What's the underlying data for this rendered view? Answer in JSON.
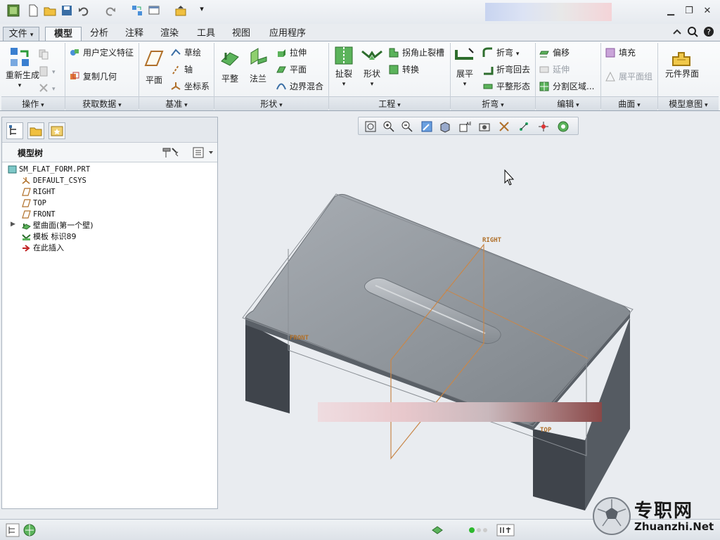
{
  "tabs": [
    "文件",
    "模型",
    "分析",
    "注释",
    "渲染",
    "工具",
    "视图",
    "应用程序"
  ],
  "ribbon": {
    "operations": {
      "regenerate": "重新生成",
      "label": "操作"
    },
    "get_data": {
      "udf": "用户定义特征",
      "copy_geometry": "复制几何",
      "label": "获取数据"
    },
    "datum": {
      "plane": "平面",
      "sketch": "草绘",
      "axis": "轴",
      "csys": "坐标系",
      "label": "基准"
    },
    "shapes": {
      "flat": "平整",
      "flange": "法兰",
      "extrude": "拉伸",
      "planar": "平面",
      "blend": "边界混合",
      "label": "形状"
    },
    "engineering": {
      "rip": "扯裂",
      "form": "形状",
      "corner_relief": "拐角止裂槽",
      "convert": "转换",
      "label": "工程"
    },
    "bends": {
      "unbend": "展平",
      "bend": "折弯",
      "bend_back": "折弯回去",
      "flat_state": "平整形态",
      "label": "折弯"
    },
    "editing": {
      "offset": "偏移",
      "extend": "延伸",
      "split_area": "分割区域...",
      "label": "编辑"
    },
    "surfaces": {
      "fill": "填充",
      "flat_pattern_group": "展平面组",
      "label": "曲面"
    },
    "design_intent": {
      "component_interface": "元件界面",
      "label": "模型意图"
    }
  },
  "tree": {
    "title": "模型树",
    "items": [
      "SM_FLAT_FORM.PRT",
      "DEFAULT_CSYS",
      "RIGHT",
      "TOP",
      "FRONT",
      "壁曲面(第一个壁)",
      "模板 标识89",
      "在此插入"
    ]
  },
  "datum_labels": {
    "right": "RIGHT",
    "front": "FRONT",
    "top": "TOP"
  },
  "watermark": {
    "cn": "专职网",
    "en": "Zhuanzhi.Net"
  },
  "colors": {
    "ribbon_bg": "#eef1f4",
    "canvas_bg": "#e9ecf0",
    "part_top": "#9aa0a6",
    "part_side": "#4a5058",
    "datum": "#c8874a"
  }
}
